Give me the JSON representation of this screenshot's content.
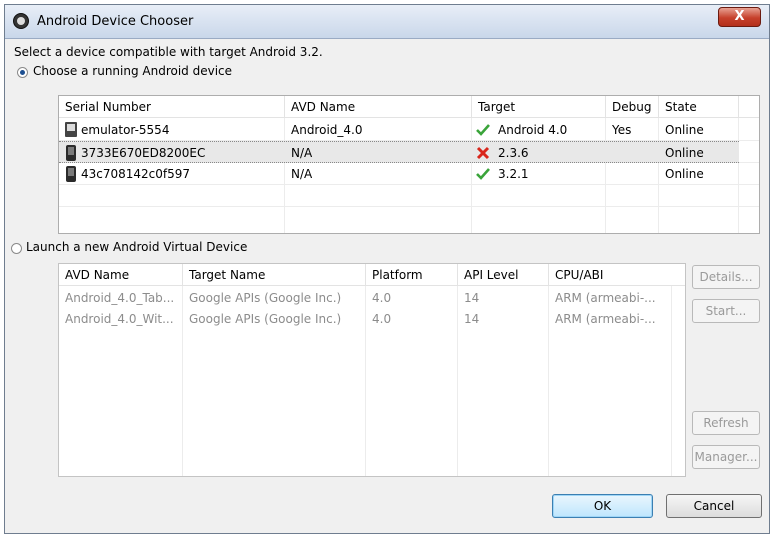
{
  "window": {
    "title": "Android Device Chooser",
    "close_label": "X"
  },
  "prompt": "Select a device compatible with target Android 3.2.",
  "running": {
    "radio_label": "Choose a running Android device",
    "selected": true,
    "columns": [
      "Serial Number",
      "AVD Name",
      "Target",
      "Debug",
      "State"
    ],
    "rows": [
      {
        "serial": "emulator-5554",
        "avd": "Android_4.0",
        "target_ok": true,
        "target": "Android 4.0",
        "debug": "Yes",
        "state": "Online",
        "icon": "emulator-icon"
      },
      {
        "serial": "3733E670ED8200EC",
        "avd": "N/A",
        "target_ok": false,
        "target": "2.3.6",
        "debug": "",
        "state": "Online",
        "icon": "phone-icon"
      },
      {
        "serial": "43c708142c0f597",
        "avd": "N/A",
        "target_ok": true,
        "target": "3.2.1",
        "debug": "",
        "state": "Online",
        "icon": "phone-icon"
      }
    ]
  },
  "launch": {
    "radio_label": "Launch a new Android Virtual Device",
    "selected": false,
    "columns": [
      "AVD Name",
      "Target Name",
      "Platform",
      "API Level",
      "CPU/ABI"
    ],
    "rows": [
      {
        "avd": "Android_4.0_Tab...",
        "target": "Google APIs (Google Inc.)",
        "platform": "4.0",
        "api": "14",
        "abi": "ARM (armeabi-..."
      },
      {
        "avd": "Android_4.0_Wit...",
        "target": "Google APIs (Google Inc.)",
        "platform": "4.0",
        "api": "14",
        "abi": "ARM (armeabi-..."
      }
    ],
    "buttons": {
      "details": "Details...",
      "start": "Start...",
      "refresh": "Refresh",
      "manager": "Manager..."
    }
  },
  "footer": {
    "ok": "OK",
    "cancel": "Cancel"
  },
  "colors": {
    "check": "#3aa43a",
    "cross": "#d9261c"
  }
}
